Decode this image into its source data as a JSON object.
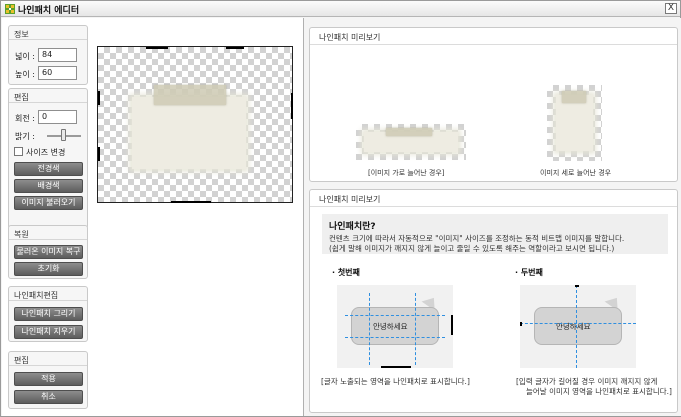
{
  "window": {
    "title": "나인패치 에디터",
    "close_label": "X"
  },
  "left": {
    "info": {
      "title": "정보",
      "width_label": "넓이 :",
      "width_value": "84",
      "height_label": "높이 :",
      "height_value": "60"
    },
    "edit": {
      "title": "편집",
      "rotate_label": "회전 :",
      "rotate_value": "0",
      "brightness_label": "밝기 :",
      "brightness_level": 0.55,
      "resize_label": "사이즈 변경",
      "fg_color_btn": "전경색",
      "bg_color_btn": "배경색",
      "load_image_btn": "이미지 불러오기"
    },
    "restore": {
      "title": "복원",
      "restore_image_btn": "물러온 이미지 복구",
      "reset_btn": "초기화"
    },
    "ninepatch_edit": {
      "title": "나인패치편집",
      "draw_btn": "나인패치 그리기",
      "clear_btn": "나인패치 지우기"
    },
    "edit2": {
      "title": "편집",
      "apply_btn": "적용",
      "cancel_btn": "취소"
    }
  },
  "right": {
    "preview_panel": {
      "title": "나인패치 미리보기",
      "caption_horizontal": "[이미지 가로 늘어난 경우]",
      "caption_vertical": "이미지 세로 늘어난 경우"
    },
    "help_panel": {
      "title": "나인패치 미리보기",
      "heading": "나인패치란?",
      "desc_line1": "컨텐츠 크기에 따라서 자동적으로 \"이미지\" 사이즈를 조정하는 동적 비트맵 이미지를 말합니다.",
      "desc_line2": "(쉽게 말해 이미지가 깨지지 않게 늘이고 줄일 수 있도록 해주는 역할이라고 보시면 됩니다.)",
      "first": {
        "heading": "· 첫번째",
        "bubble_text": "안녕하세요",
        "caption": "[글자 노출되는 영역을 나인패치로 표시합니다.]"
      },
      "second": {
        "heading": "· 두번째",
        "bubble_text": "안녕하세요",
        "caption_line1": "[입력 글자가 길어질 경우 이미지 깨지지 않게",
        "caption_line2": "늘어날 이미지 영역을 나인패치로 표시합니다.]"
      }
    }
  },
  "colors": {
    "button": "#6e6e6e",
    "guide": "#2f8fe0",
    "paper": "#eeece2"
  },
  "icons": {
    "app": "ninepatch-app-icon",
    "close": "close-icon"
  }
}
